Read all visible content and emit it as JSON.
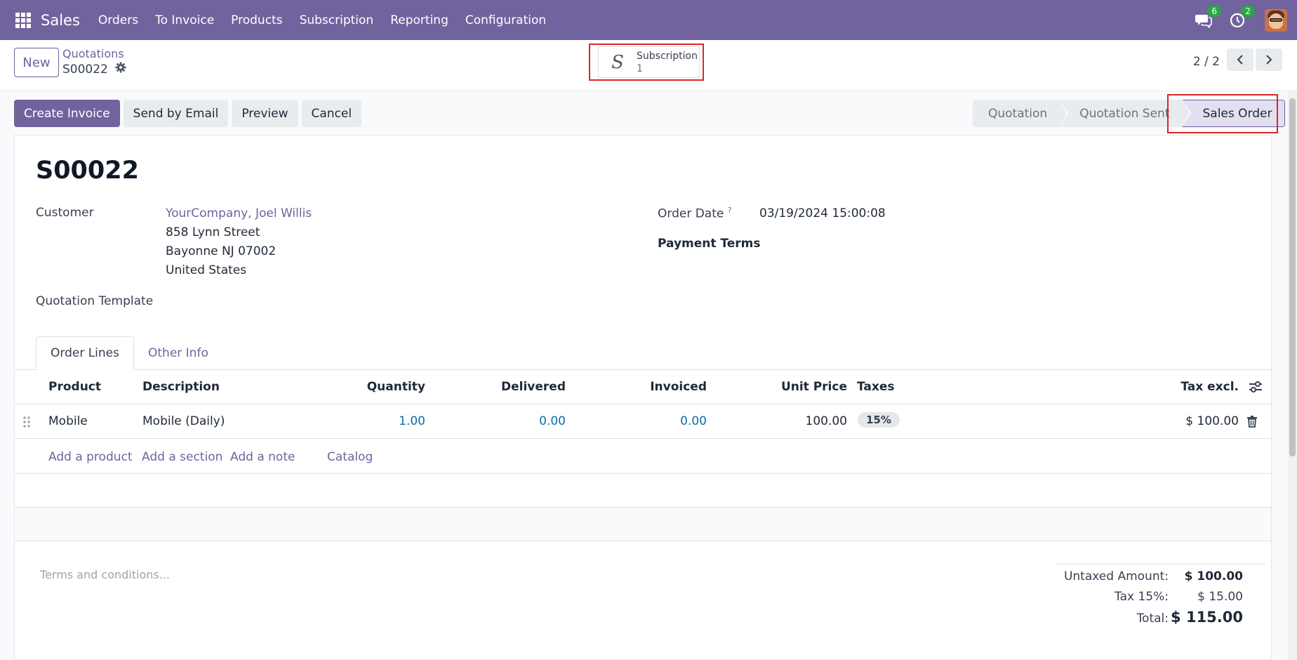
{
  "navbar": {
    "app_name": "Sales",
    "menu": [
      "Orders",
      "To Invoice",
      "Products",
      "Subscription",
      "Reporting",
      "Configuration"
    ],
    "messages_count": "6",
    "activities_count": "2"
  },
  "control": {
    "new_label": "New",
    "breadcrumb_parent": "Quotations",
    "breadcrumb_current": "S00022",
    "smart_button": {
      "title": "Subscription",
      "count": "1"
    },
    "pager": "2 / 2"
  },
  "actions": {
    "create_invoice": "Create Invoice",
    "send_email": "Send by Email",
    "preview": "Preview",
    "cancel": "Cancel"
  },
  "statusbar": {
    "stages": [
      "Quotation",
      "Quotation Sent",
      "Sales Order"
    ],
    "active": "Sales Order"
  },
  "form": {
    "title": "S00022",
    "customer_label": "Customer",
    "customer_name": "YourCompany, Joel Willis",
    "address": [
      "858 Lynn Street",
      "Bayonne NJ 07002",
      "United States"
    ],
    "quotation_template_label": "Quotation Template",
    "order_date_label": "Order Date",
    "order_date_help": "?",
    "order_date": "03/19/2024 15:00:08",
    "payment_terms_label": "Payment Terms"
  },
  "tabs": [
    "Order Lines",
    "Other Info"
  ],
  "table": {
    "headers": {
      "product": "Product",
      "description": "Description",
      "quantity": "Quantity",
      "delivered": "Delivered",
      "invoiced": "Invoiced",
      "unit_price": "Unit Price",
      "taxes": "Taxes",
      "tax_excl": "Tax excl."
    },
    "rows": [
      {
        "product": "Mobile",
        "description": "Mobile (Daily)",
        "quantity": "1.00",
        "delivered": "0.00",
        "invoiced": "0.00",
        "unit_price": "100.00",
        "tax": "15%",
        "subtotal": "$ 100.00"
      }
    ],
    "add_links": [
      "Add a product",
      "Add a section",
      "Add a note",
      "Catalog"
    ]
  },
  "footer": {
    "terms_placeholder": "Terms and conditions...",
    "untaxed_label": "Untaxed Amount:",
    "untaxed_value": "$ 100.00",
    "tax_label": "Tax 15%:",
    "tax_value": "$ 15.00",
    "total_label": "Total:",
    "total_value": "$ 115.00"
  },
  "colors": {
    "brand": "#71639e",
    "highlight": "#dc2626",
    "number_link": "#0b6ea8",
    "badge": "#28a745"
  }
}
